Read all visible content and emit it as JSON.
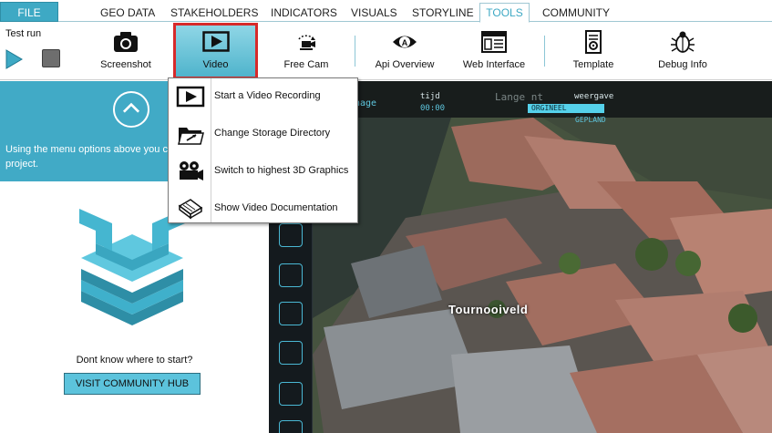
{
  "menu": {
    "file": "FILE",
    "tabs": [
      "GEO DATA",
      "STAKEHOLDERS",
      "INDICATORS",
      "VISUALS",
      "STORYLINE",
      "TOOLS",
      "COMMUNITY"
    ],
    "active_tab": "TOOLS"
  },
  "toolbar": {
    "test_run": "Test run",
    "tools": [
      {
        "label": "Screenshot",
        "icon": "camera-icon"
      },
      {
        "label": "Video",
        "icon": "video-icon"
      },
      {
        "label": "Free Cam",
        "icon": "free-cam-icon"
      },
      {
        "label": "Api Overview",
        "icon": "eye-icon"
      },
      {
        "label": "Web Interface",
        "icon": "browser-window-icon"
      },
      {
        "label": "Template",
        "icon": "template-document-icon"
      },
      {
        "label": "Debug Info",
        "icon": "bug-icon"
      }
    ],
    "selected_tool": "Video"
  },
  "left_panel": {
    "info_text_line1": "Using the menu options above you c",
    "info_text_line2": "project.",
    "help_text": "Dont know where to start?",
    "hub_button": "VISIT COMMUNITY HUB"
  },
  "dropdown": {
    "items": [
      {
        "label": "Start a Video Recording",
        "icon": "play-box-icon"
      },
      {
        "label": "Change Storage Directory",
        "icon": "folder-icon"
      },
      {
        "label": "Switch to highest 3D Graphics",
        "icon": "film-camera-icon"
      },
      {
        "label": "Show Video Documentation",
        "icon": "book-icon"
      }
    ]
  },
  "view3d": {
    "overlay_partial": "hage",
    "tijd_label": "tijd",
    "tijd_value": "00:00",
    "weergave_label": "weergave",
    "option_selected": "ORGINEEL",
    "option_other": "GEPLAND",
    "street_faded": "Lange        nt",
    "place_label": "Tournooiveld"
  },
  "colors": {
    "accent": "#41aac6",
    "selection_border": "#d72a2a",
    "overlay_cyan": "#55d1ea"
  }
}
